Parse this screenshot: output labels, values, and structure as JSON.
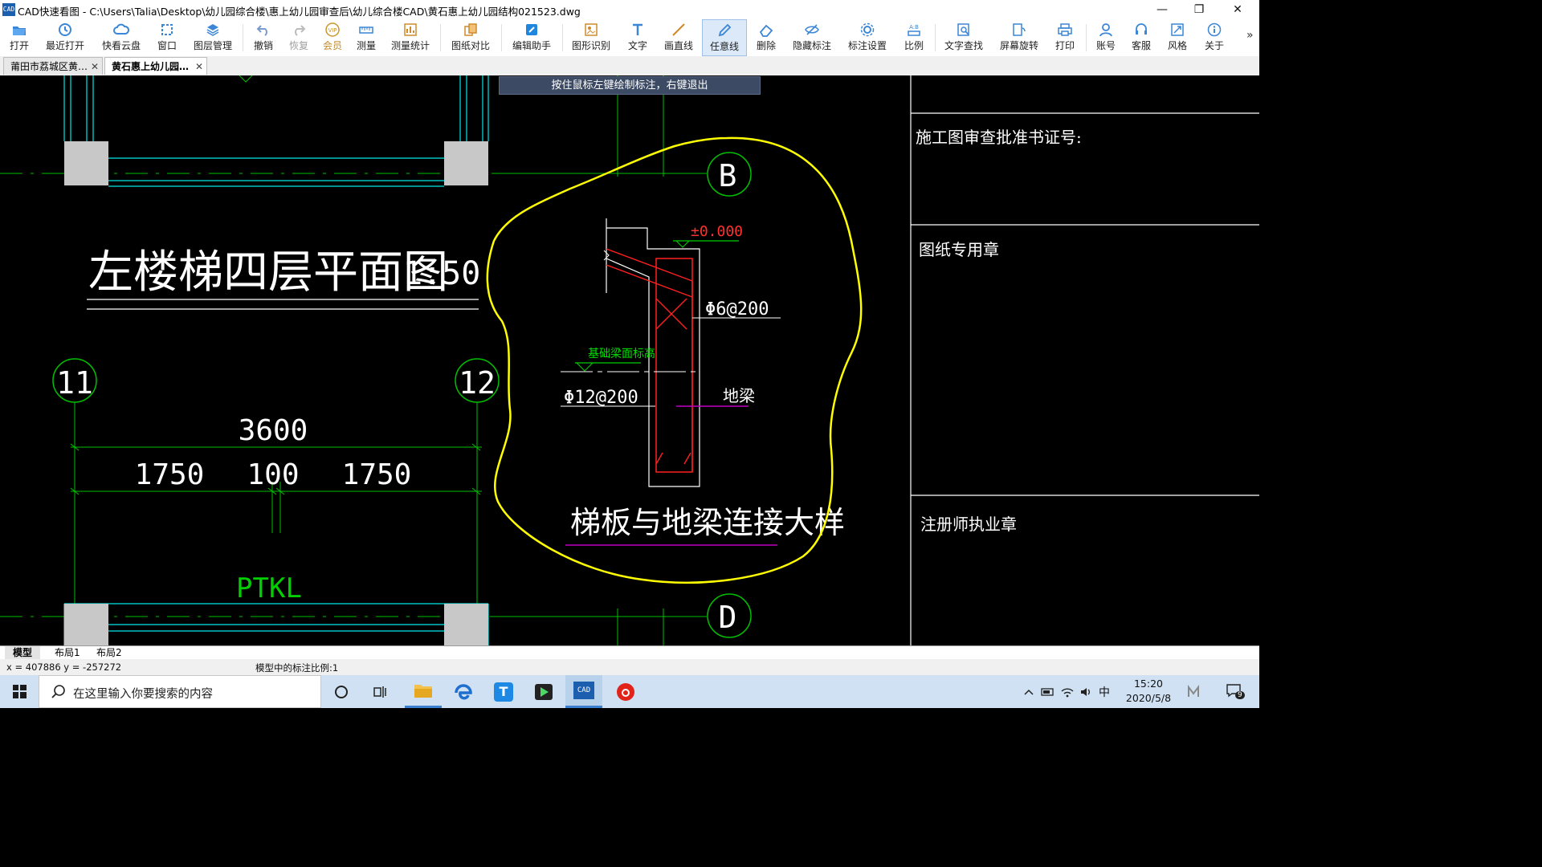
{
  "window": {
    "title": "CAD快速看图 - C:\\Users\\Talia\\Desktop\\幼儿园综合楼\\惠上幼儿园审查后\\幼儿综合楼CAD\\黄石惠上幼儿园结构021523.dwg",
    "app_icon_text": "CAD",
    "minimize": "—",
    "restore": "❐",
    "close": "✕"
  },
  "toolbar": {
    "items": [
      {
        "label": "打开",
        "icon": "folder-open-icon"
      },
      {
        "label": "最近打开",
        "icon": "clock-history-icon"
      },
      {
        "label": "快看云盘",
        "icon": "cloud-icon"
      },
      {
        "label": "窗口",
        "icon": "window-icon"
      },
      {
        "label": "图层管理",
        "icon": "layers-icon"
      },
      {
        "label": "撤销",
        "icon": "undo-icon"
      },
      {
        "label": "恢复",
        "icon": "redo-icon"
      },
      {
        "label": "会员",
        "icon": "vip-icon"
      },
      {
        "label": "测量",
        "icon": "ruler-icon"
      },
      {
        "label": "测量统计",
        "icon": "measure-stats-icon"
      },
      {
        "label": "图纸对比",
        "icon": "compare-icon"
      },
      {
        "label": "编辑助手",
        "icon": "edit-assistant-icon"
      },
      {
        "label": "图形识别",
        "icon": "shape-recognize-icon"
      },
      {
        "label": "文字",
        "icon": "text-icon"
      },
      {
        "label": "画直线",
        "icon": "line-icon"
      },
      {
        "label": "任意线",
        "icon": "freehand-pen-icon"
      },
      {
        "label": "删除",
        "icon": "eraser-icon"
      },
      {
        "label": "隐藏标注",
        "icon": "eye-hide-icon"
      },
      {
        "label": "标注设置",
        "icon": "annotation-settings-icon"
      },
      {
        "label": "比例",
        "icon": "scale-icon"
      },
      {
        "label": "文字查找",
        "icon": "text-search-icon"
      },
      {
        "label": "屏幕旋转",
        "icon": "rotate-screen-icon"
      },
      {
        "label": "打印",
        "icon": "printer-icon"
      },
      {
        "label": "账号",
        "icon": "user-icon"
      },
      {
        "label": "客服",
        "icon": "headset-icon"
      },
      {
        "label": "风格",
        "icon": "style-icon"
      },
      {
        "label": "关于",
        "icon": "info-icon"
      }
    ],
    "more": "»",
    "vip_text": "VIP",
    "scale_text": "A:B"
  },
  "doc_tabs": [
    {
      "label": "莆田市荔城区黄…",
      "close": "✕"
    },
    {
      "label": "黄石惠上幼儿园…",
      "close": "✕"
    }
  ],
  "canvas": {
    "hint": "按住鼠标左键绘制标注，右键退出",
    "drawing": {
      "title": "左楼梯四层平面图",
      "scale": "1:50",
      "axis_11": "11",
      "axis_12": "12",
      "axis_B": "B",
      "axis_D": "D",
      "dim_total": "3600",
      "dim_left": "1750",
      "dim_mid": "100",
      "dim_right": "1750",
      "beam_label": "PTKL",
      "elevation": "±0.000",
      "rebar_1": "Φ6@200",
      "rebar_2": "Φ12@200",
      "beam_top_label": "基础梁面标高",
      "ground_beam": "地梁",
      "detail_title": "梯板与地梁连接大样"
    },
    "title_block": {
      "approval": "施工图审查批准书证号:",
      "seal": "图纸专用章",
      "engineer_seal": "注册师执业章"
    },
    "colors": {
      "annotation": "#ffff00",
      "axis": "#00c000",
      "wall": "#00ffff",
      "rebar": "#ff2020"
    }
  },
  "layout_tabs": [
    "模型",
    "布局1",
    "布局2"
  ],
  "status": {
    "coords": "x = 407886  y = -257272",
    "scale_note": "模型中的标注比例:1"
  },
  "taskbar": {
    "search_placeholder": "在这里输入你要搜索的内容",
    "ime": "中",
    "time": "15:20",
    "date": "2020/5/8",
    "notifications": "9",
    "cad_app_text": "CAD",
    "tao_app_text": "T"
  }
}
